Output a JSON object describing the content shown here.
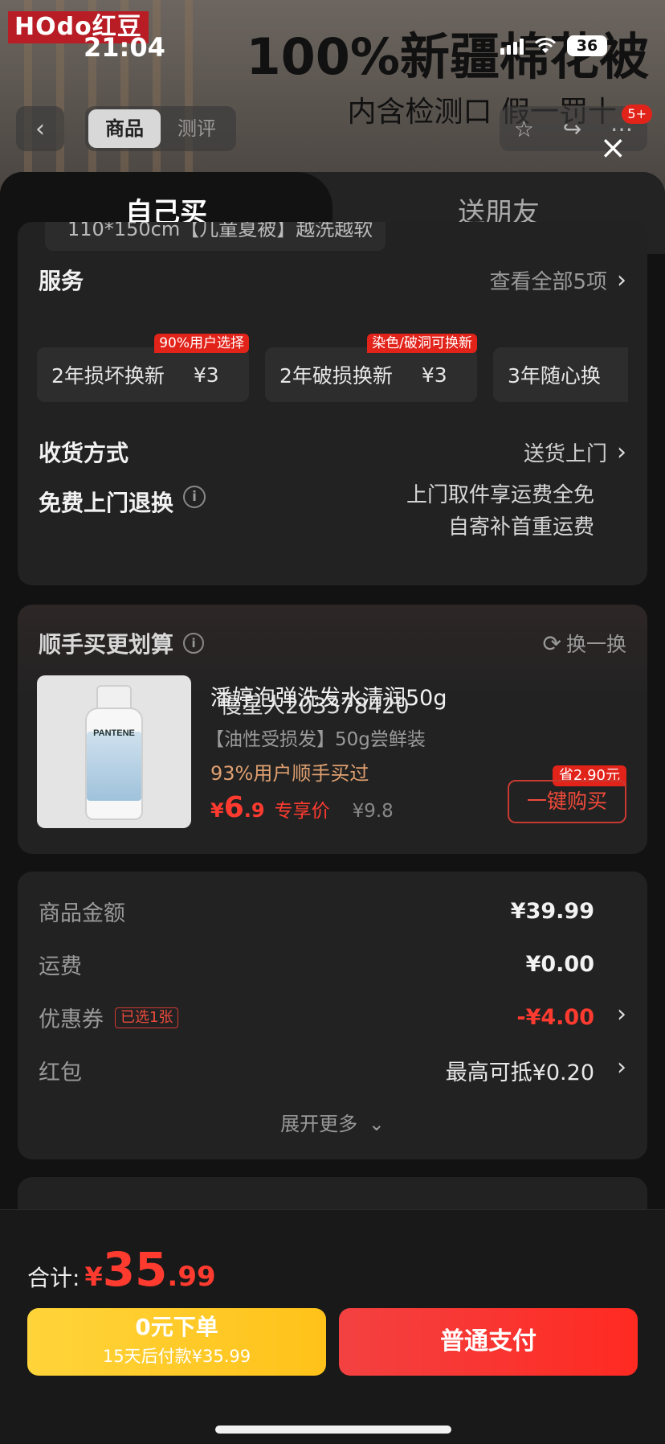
{
  "background": {
    "brand": "HOdo红豆",
    "promo_title": "100%新疆棉花被",
    "promo_subtitle": "内含检测口 假一罚十"
  },
  "status_bar": {
    "time": "21:04",
    "battery": "36"
  },
  "nav": {
    "back_icon": "‹",
    "tabs": [
      "商品",
      "测评"
    ],
    "badge": "5+",
    "close_icon": "×"
  },
  "sheet_tabs": [
    "自己买",
    "送朋友"
  ],
  "peek_text": "110*150cm【儿童夏被】越洗越软",
  "service": {
    "title": "服务",
    "view_all": "查看全部5项",
    "options": [
      {
        "name": "2年损坏换新",
        "price": "¥3",
        "tag": "90%用户选择"
      },
      {
        "name": "2年破损换新",
        "price": "¥3",
        "tag": "染色/破洞可换新"
      },
      {
        "name": "3年随心换",
        "price": "",
        "tag": ""
      }
    ]
  },
  "delivery": {
    "label": "收货方式",
    "value": "送货上门"
  },
  "free_return": {
    "label": "免费上门退换",
    "line1": "上门取件享运费全免",
    "line2": "自寄补首重运费"
  },
  "addon": {
    "title": "顺手买更划算",
    "refresh": "换一换",
    "product_name": "潘婷泡弹洗发水清润50g",
    "overlay_text": "慢星人203378420",
    "spec": "【油性受损发】50g尝鲜装",
    "stat": "93%用户顺手买过",
    "price_symbol": "¥",
    "price_int": "6",
    "price_dec": ".9",
    "price_label": "专享价",
    "original_price": "¥9.8",
    "save_tag": "省2.90元",
    "buy_label": "一键购买",
    "image_brand": "PANTENE"
  },
  "summary": {
    "rows": [
      {
        "label": "商品金额",
        "value": "¥39.99"
      },
      {
        "label": "运费",
        "value": "¥0.00"
      },
      {
        "label": "优惠券",
        "tag": "已选1张",
        "value": "-¥4.00"
      },
      {
        "label": "红包",
        "value": "最高可抵¥0.20"
      }
    ],
    "expand": "展开更多"
  },
  "bottom": {
    "total_label": "合计:",
    "total_symbol": "¥",
    "total_int": "35",
    "total_dec": ".99",
    "pay_later_line1": "0元下单",
    "pay_later_line2": "15天后付款¥35.99",
    "pay_now": "普通支付"
  },
  "colors": {
    "accent_red": "#ff3b30",
    "pay_later_yellow": "#ffc21a",
    "card_bg": "#222222"
  }
}
